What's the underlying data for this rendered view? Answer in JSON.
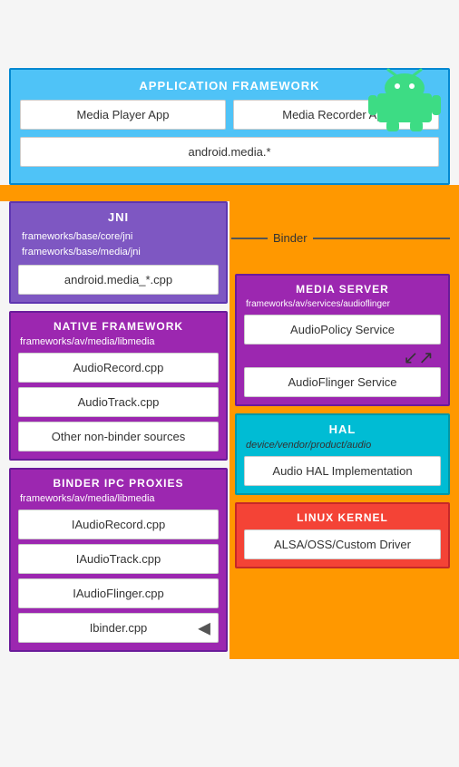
{
  "android_logo": {
    "alt": "Android Logo"
  },
  "app_framework": {
    "title": "APPLICATION FRAMEWORK",
    "media_player": "Media Player App",
    "media_recorder": "Media Recorder App",
    "android_media": "android.media.*"
  },
  "jni": {
    "title": "JNI",
    "path1": "frameworks/base/core/jni",
    "path2": "frameworks/base/media/jni",
    "cpp": "android.media_*.cpp"
  },
  "binder": {
    "label": "Binder"
  },
  "native_framework": {
    "title": "NATIVE FRAMEWORK",
    "path": "frameworks/av/media/libmedia",
    "items": [
      "AudioRecord.cpp",
      "AudioTrack.cpp",
      "Other non-binder sources"
    ]
  },
  "media_server": {
    "title": "MEDIA SERVER",
    "path": "frameworks/av/services/audioflinger",
    "items": [
      "AudioPolicy Service",
      "AudioFlinger Service"
    ]
  },
  "binder_ipc": {
    "title": "BINDER IPC PROXIES",
    "path": "frameworks/av/media/libmedia",
    "items": [
      "IAudioRecord.cpp",
      "IAudioTrack.cpp",
      "IAudioFlinger.cpp",
      "Ibinder.cpp"
    ]
  },
  "hal": {
    "title": "HAL",
    "path": "device/vendor/product/audio",
    "item": "Audio HAL Implementation"
  },
  "linux_kernel": {
    "title": "LINUX KERNEL",
    "item": "ALSA/OSS/Custom Driver"
  }
}
